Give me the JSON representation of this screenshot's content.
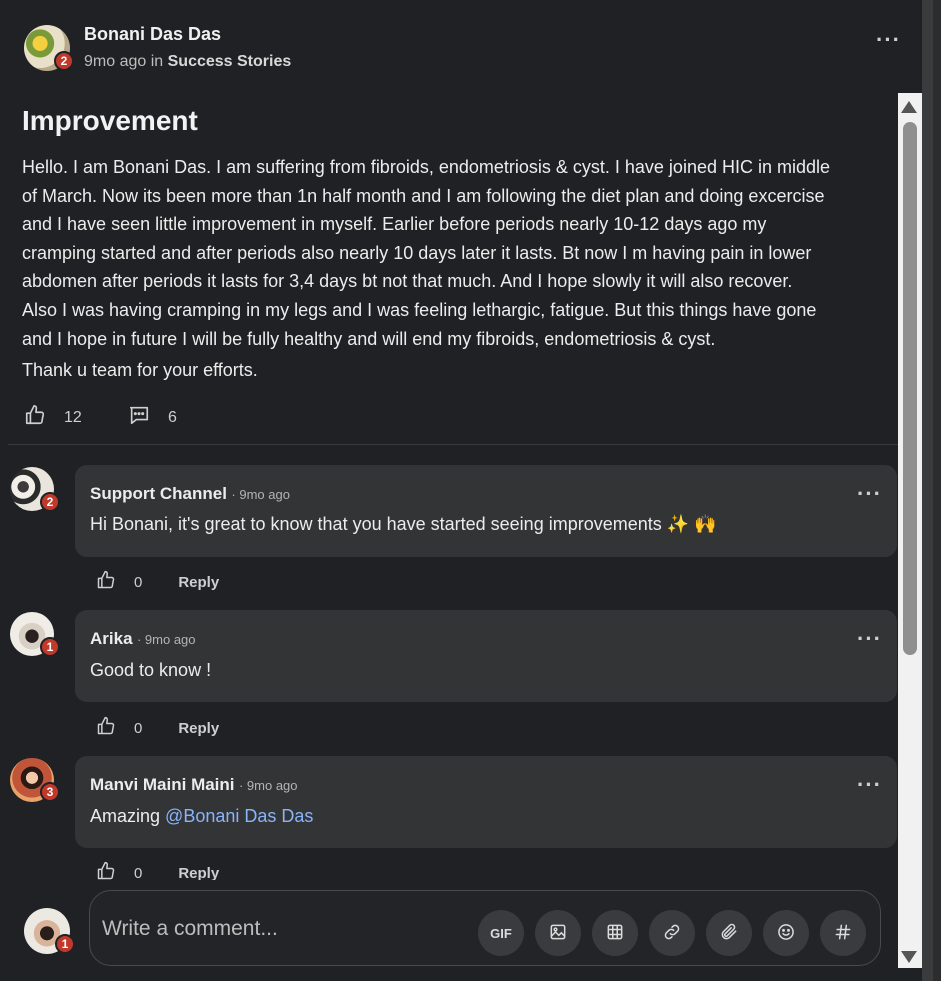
{
  "post": {
    "author": "Bonani Das Das",
    "badge": "2",
    "time": "9mo ago",
    "in_word": "in",
    "category": "Success Stories",
    "title": "Improvement",
    "body_lines": [
      "Hello. I am Bonani Das. I am suffering from fibroids, endometriosis & cyst. I have joined HIC in middle",
      "of March. Now its been more than 1n half month and I am following the diet plan and doing excercise",
      "and I have seen little improvement in myself. Earlier before periods nearly 10-12 days ago my",
      "cramping started and after periods also nearly 10 days later it lasts. Bt now I m having pain in lower",
      "abdomen after periods it lasts for 3,4 days bt not that much. And I hope slowly it will also recover.",
      "Also I was having cramping in my legs and I was feeling lethargic, fatigue. But this things have gone",
      "and I hope in future I will be fully healthy and will end my fibroids, endometriosis & cyst."
    ],
    "closing": "Thank u team for your efforts.",
    "likes": "12",
    "comments_count": "6",
    "menu": "···"
  },
  "comments": [
    {
      "name": "Support Channel",
      "time": "· 9mo ago",
      "text": "Hi Bonani, it's great to know that you have started seeing improvements ✨ 🙌",
      "badge": "2",
      "likes": "0",
      "reply": "Reply",
      "menu": "···"
    },
    {
      "name": "Arika",
      "time": "· 9mo ago",
      "text": "Good to know !",
      "badge": "1",
      "likes": "0",
      "reply": "Reply",
      "menu": "···"
    },
    {
      "name": "Manvi Maini Maini",
      "time": "· 9mo ago",
      "text_prefix": "Amazing ",
      "mention": "@Bonani Das Das",
      "badge": "3",
      "likes": "0",
      "reply": "Reply",
      "menu": "···"
    }
  ],
  "composer": {
    "placeholder": "Write a comment...",
    "badge": "1",
    "gif_label": "GIF",
    "tools": [
      "gif-icon",
      "image-icon",
      "table-icon",
      "link-icon",
      "attachment-icon",
      "emoji-icon",
      "hashtag-icon"
    ]
  },
  "colors": {
    "background": "#202124",
    "comment_bg": "#333436",
    "badge": "#c0392b",
    "mention": "#8ab4f8"
  }
}
